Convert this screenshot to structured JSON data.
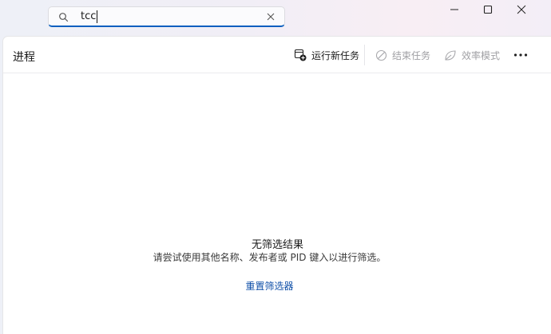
{
  "search": {
    "value": "tcc",
    "placeholder": ""
  },
  "header": {
    "title": "进程"
  },
  "toolbar": {
    "run_new_task": "运行新任务",
    "end_task": "结束任务",
    "efficiency_mode": "效率模式"
  },
  "empty_state": {
    "title": "无筛选结果",
    "description": "请尝试使用其他名称、发布者或 PID 键入以进行筛选。",
    "reset_link": "重置筛选器"
  }
}
